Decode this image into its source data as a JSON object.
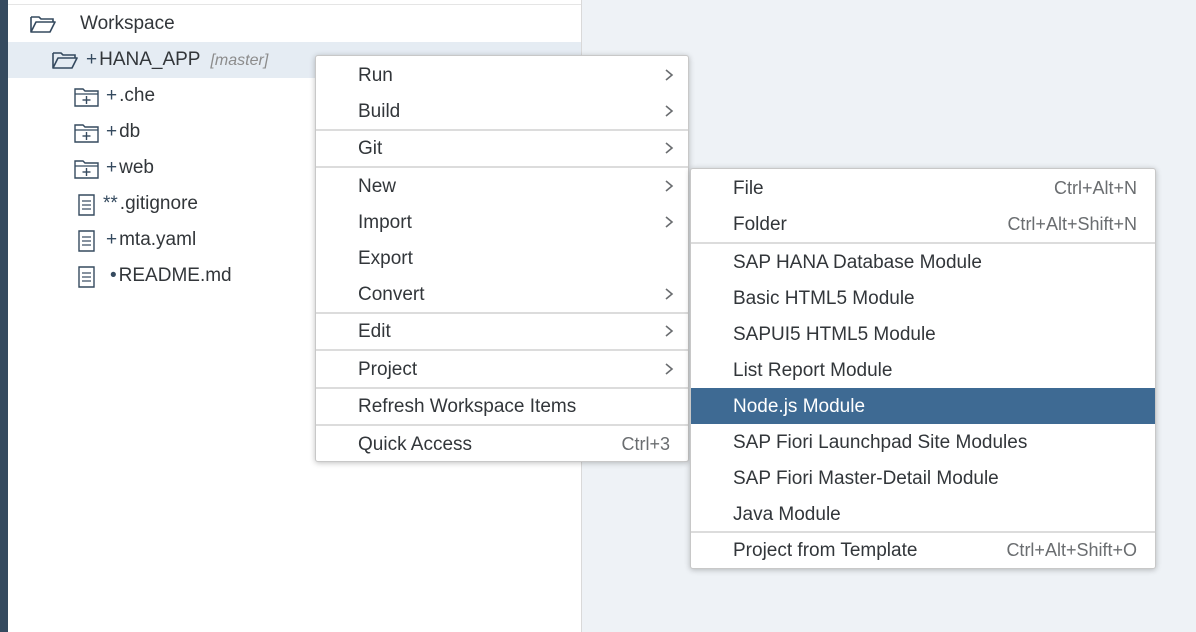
{
  "tree": {
    "root": {
      "label": "Workspace"
    },
    "project": {
      "prefix": "+",
      "label": "HANA_APP",
      "branch": "[master]"
    },
    "children": [
      {
        "prefix": "+",
        "label": ".che",
        "icon": "folder-icon"
      },
      {
        "prefix": "+",
        "label": "db",
        "icon": "folder-icon"
      },
      {
        "prefix": "+",
        "label": "web",
        "icon": "folder-icon"
      },
      {
        "prefix": "**",
        "label": ".gitignore",
        "icon": "file-icon"
      },
      {
        "prefix": "+",
        "label": "mta.yaml",
        "icon": "file-icon"
      },
      {
        "prefix": "•",
        "label": "README.md",
        "icon": "file-icon"
      }
    ]
  },
  "context_menu": {
    "items": [
      {
        "label": "Run",
        "submenu": true
      },
      {
        "label": "Build",
        "submenu": true
      },
      {
        "label": "Git",
        "submenu": true
      },
      {
        "label": "New",
        "submenu": true
      },
      {
        "label": "Import",
        "submenu": true
      },
      {
        "label": "Export",
        "submenu": false
      },
      {
        "label": "Convert",
        "submenu": true
      },
      {
        "label": "Edit",
        "submenu": true
      },
      {
        "label": "Project",
        "submenu": true
      },
      {
        "label": "Refresh Workspace Items",
        "submenu": false
      },
      {
        "label": "Quick Access",
        "shortcut": "Ctrl+3"
      }
    ]
  },
  "new_submenu": {
    "items": [
      {
        "label": "File",
        "shortcut": "Ctrl+Alt+N"
      },
      {
        "label": "Folder",
        "shortcut": "Ctrl+Alt+Shift+N"
      },
      {
        "label": "SAP HANA Database Module"
      },
      {
        "label": "Basic HTML5 Module"
      },
      {
        "label": "SAPUI5 HTML5 Module"
      },
      {
        "label": "List Report Module"
      },
      {
        "label": "Node.js Module",
        "highlighted": true
      },
      {
        "label": "SAP Fiori Launchpad Site Modules"
      },
      {
        "label": "SAP Fiori Master-Detail Module"
      },
      {
        "label": "Java Module"
      },
      {
        "label": "Project from Template",
        "shortcut": "Ctrl+Alt+Shift+O"
      }
    ]
  },
  "colors": {
    "highlight": "#3e6a93",
    "shell_strip": "#354a5f",
    "selected_row": "#e5ecf3"
  }
}
